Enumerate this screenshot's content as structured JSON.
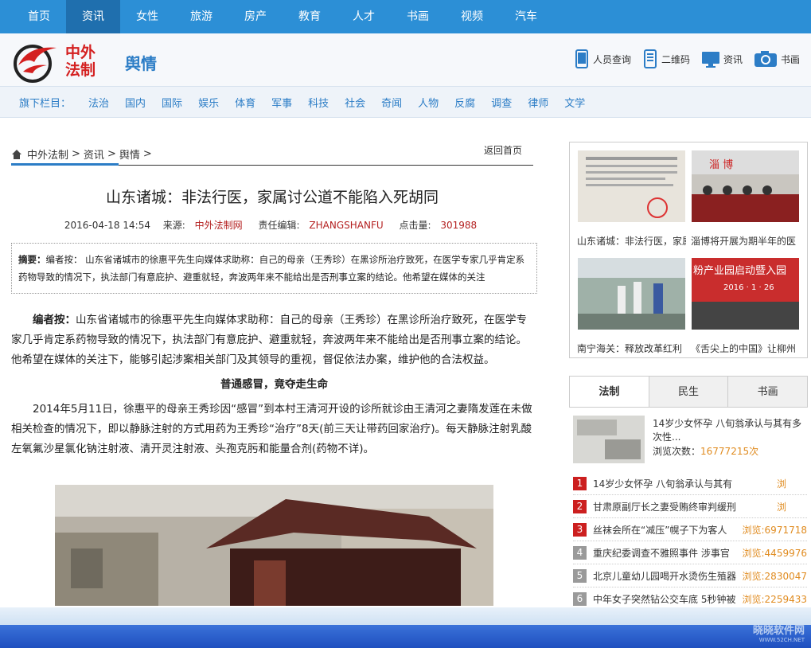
{
  "topnav": [
    "首页",
    "资讯",
    "女性",
    "旅游",
    "房产",
    "教育",
    "人才",
    "书画",
    "视频",
    "汽车"
  ],
  "logo": {
    "line1": "中外",
    "line2": "法制"
  },
  "section_title": "舆情",
  "header_links": [
    {
      "label": "人员查询",
      "icon": "phone-icon"
    },
    {
      "label": "二维码",
      "icon": "qrcode-phone-icon"
    },
    {
      "label": "资讯",
      "icon": "monitor-icon"
    },
    {
      "label": "书画",
      "icon": "camera-icon"
    }
  ],
  "subnav": {
    "lead": "旗下栏目：",
    "items": [
      "法治",
      "国内",
      "国际",
      "娱乐",
      "体育",
      "军事",
      "科技",
      "社会",
      "奇闻",
      "人物",
      "反腐",
      "调查",
      "律师",
      "文学"
    ]
  },
  "breadcrumb": {
    "home": "中外法制",
    "sep1": ">",
    "c2": "资讯",
    "sep2": ">",
    "c3": "舆情",
    "sep3": ">",
    "back": "返回首页"
  },
  "article": {
    "title": "山东诸城：非法行医，家属讨公道不能陷入死胡同",
    "date": "2016-04-18 14:54",
    "source_label": "来源:",
    "source": "中外法制网",
    "editor_label": "责任编辑:",
    "editor": "ZHANGSHANFU",
    "clicks_label": "点击量:",
    "clicks": "301988",
    "summary_label": "摘要：",
    "summary": "编者按：  山东省诸城市的徐惠平先生向媒体求助称：自己的母亲（王秀珍）在黑诊所治疗致死，在医学专家几乎肯定系药物导致的情况下，执法部门有意庇护、避重就轻，奔波两年来不能给出是否刑事立案的结论。他希望在媒体的关注",
    "editor_note_label": "编者按：",
    "editor_note": "山东省诸城市的徐惠平先生向媒体求助称：自己的母亲（王秀珍）在黑诊所治疗致死，在医学专家几乎肯定系药物导致的情况下，执法部门有意庇护、避重就轻，奔波两年来不能给出是否刑事立案的结论。他希望在媒体的关注下，能够引起涉案相关部门及其领导的重视，督促依法办案，维护他的合法权益。",
    "subhead": "普通感冒，竟夺走生命",
    "para1": "2014年5月11日，徐惠平的母亲王秀珍因“感冒”到本村王清河开设的诊所就诊由王清河之妻隋发莲在未做相关检查的情况下，即以静脉注射的方式用药为王秀珍“治疗”8天(前三天让带药回家治疗)。每天静脉注射乳酸左氧氟沙星氯化钠注射液、清开灵注射液、头孢克肟和能量合剂(药物不详)。"
  },
  "side_gallery": [
    "山东诸城：非法行医，家属讨公道",
    "淄博将开展为期半年的医",
    "南宁海关：释放改革红利",
    "《舌尖上的中国》让柳州"
  ],
  "gallery_overlay_text": [
    "淄 博",
    "粉产业园启动暨入园",
    "2016 · 1 · 26"
  ],
  "tabs": [
    "法制",
    "民生",
    "书画"
  ],
  "featured": {
    "title": "14岁少女怀孕 八旬翁承认与其有多次性...",
    "count_label": "浏览次数：",
    "count": "16777215次"
  },
  "ranking": [
    {
      "no": "1",
      "title": "14岁少女怀孕 八旬翁承认与其有",
      "count": "浏"
    },
    {
      "no": "2",
      "title": "甘肃原副厅长之妻受贿终审判缓刑",
      "count": "浏"
    },
    {
      "no": "3",
      "title": "丝袜会所在“减压”幌子下为客人",
      "count": "浏览:6971718"
    },
    {
      "no": "4",
      "title": "重庆纪委调查不雅照事件 涉事官",
      "count": "浏览:4459976"
    },
    {
      "no": "5",
      "title": "北京儿童幼儿园喝开水烫伤生殖器",
      "count": "浏览:2830047"
    },
    {
      "no": "6",
      "title": "中年女子突然钻公交车底 5秒钟被",
      "count": "浏览:2259433"
    }
  ],
  "watermark": {
    "main": "晓晓软件网",
    "sub": "WWW.52CH.NET"
  },
  "colors": {
    "nav_blue": "#2c8fd6",
    "accent_blue": "#2c7dc6",
    "brand_red": "#d42020",
    "count_orange": "#e08b1f"
  }
}
